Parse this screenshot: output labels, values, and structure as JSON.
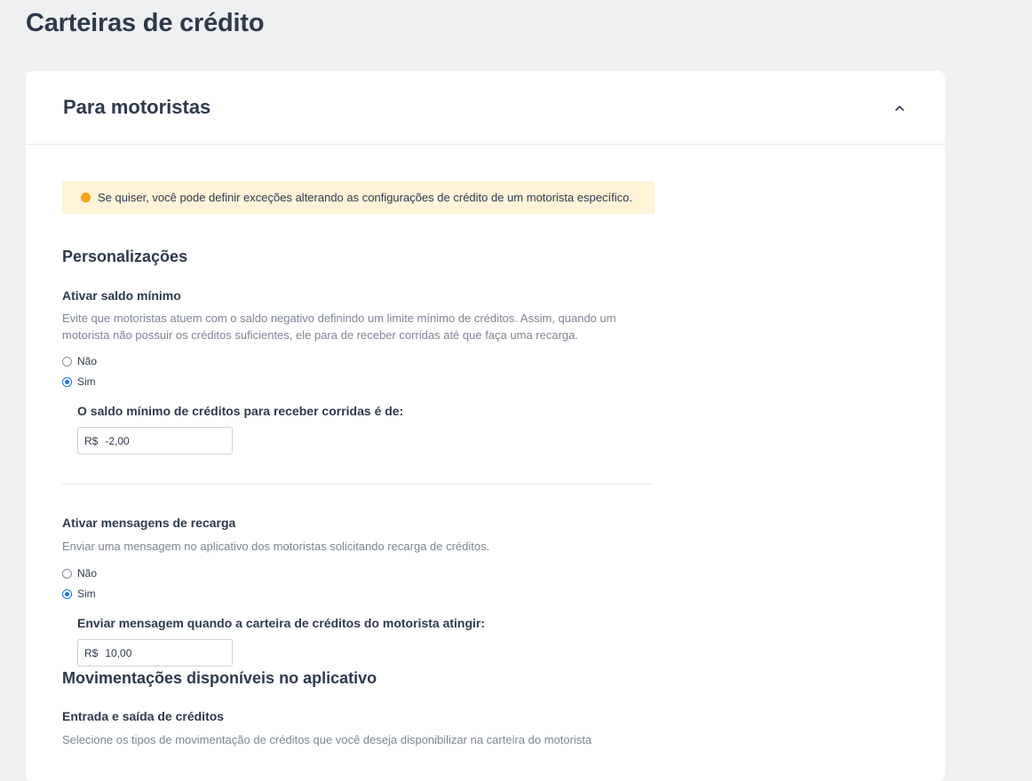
{
  "page": {
    "title": "Carteiras de crédito"
  },
  "card": {
    "title": "Para motoristas",
    "notice": "Se quiser, você pode definir exceções alterando as configurações de crédito de um motorista específico."
  },
  "personalizacoes": {
    "title": "Personalizações",
    "saldo_minimo": {
      "title": "Ativar saldo mínimo",
      "description": "Evite que motoristas atuem com o saldo negativo definindo um limite mínimo de créditos. Assim, quando um motorista não possuir os créditos suficientes, ele para de receber corridas até que faça uma recarga.",
      "option_no": "Não",
      "option_yes": "Sim",
      "selected": "Sim",
      "sub_label": "O saldo mínimo de créditos para receber corridas é de:",
      "currency": "R$",
      "value": "-2,00"
    },
    "mensagens_recarga": {
      "title": "Ativar mensagens de recarga",
      "description": "Enviar uma mensagem no aplicativo dos motoristas solicitando recarga de créditos.",
      "option_no": "Não",
      "option_yes": "Sim",
      "selected": "Sim",
      "sub_label": "Enviar mensagem quando a carteira de créditos do motorista atingir:",
      "currency": "R$",
      "value": "10,00"
    }
  },
  "movimentacoes": {
    "title": "Movimentações disponíveis no aplicativo",
    "entrada_saida": {
      "title": "Entrada e saída de créditos",
      "description": "Selecione os tipos de movimentação de créditos que você deseja disponibilizar na carteira do motorista"
    }
  },
  "colors": {
    "background": "#eff0f2",
    "card": "#ffffff",
    "notice_bg": "#fff3d8",
    "notice_dot": "#f5a316",
    "radio_checked": "#1a73e8",
    "text": "#2e3a4b",
    "muted": "#7d8694"
  }
}
